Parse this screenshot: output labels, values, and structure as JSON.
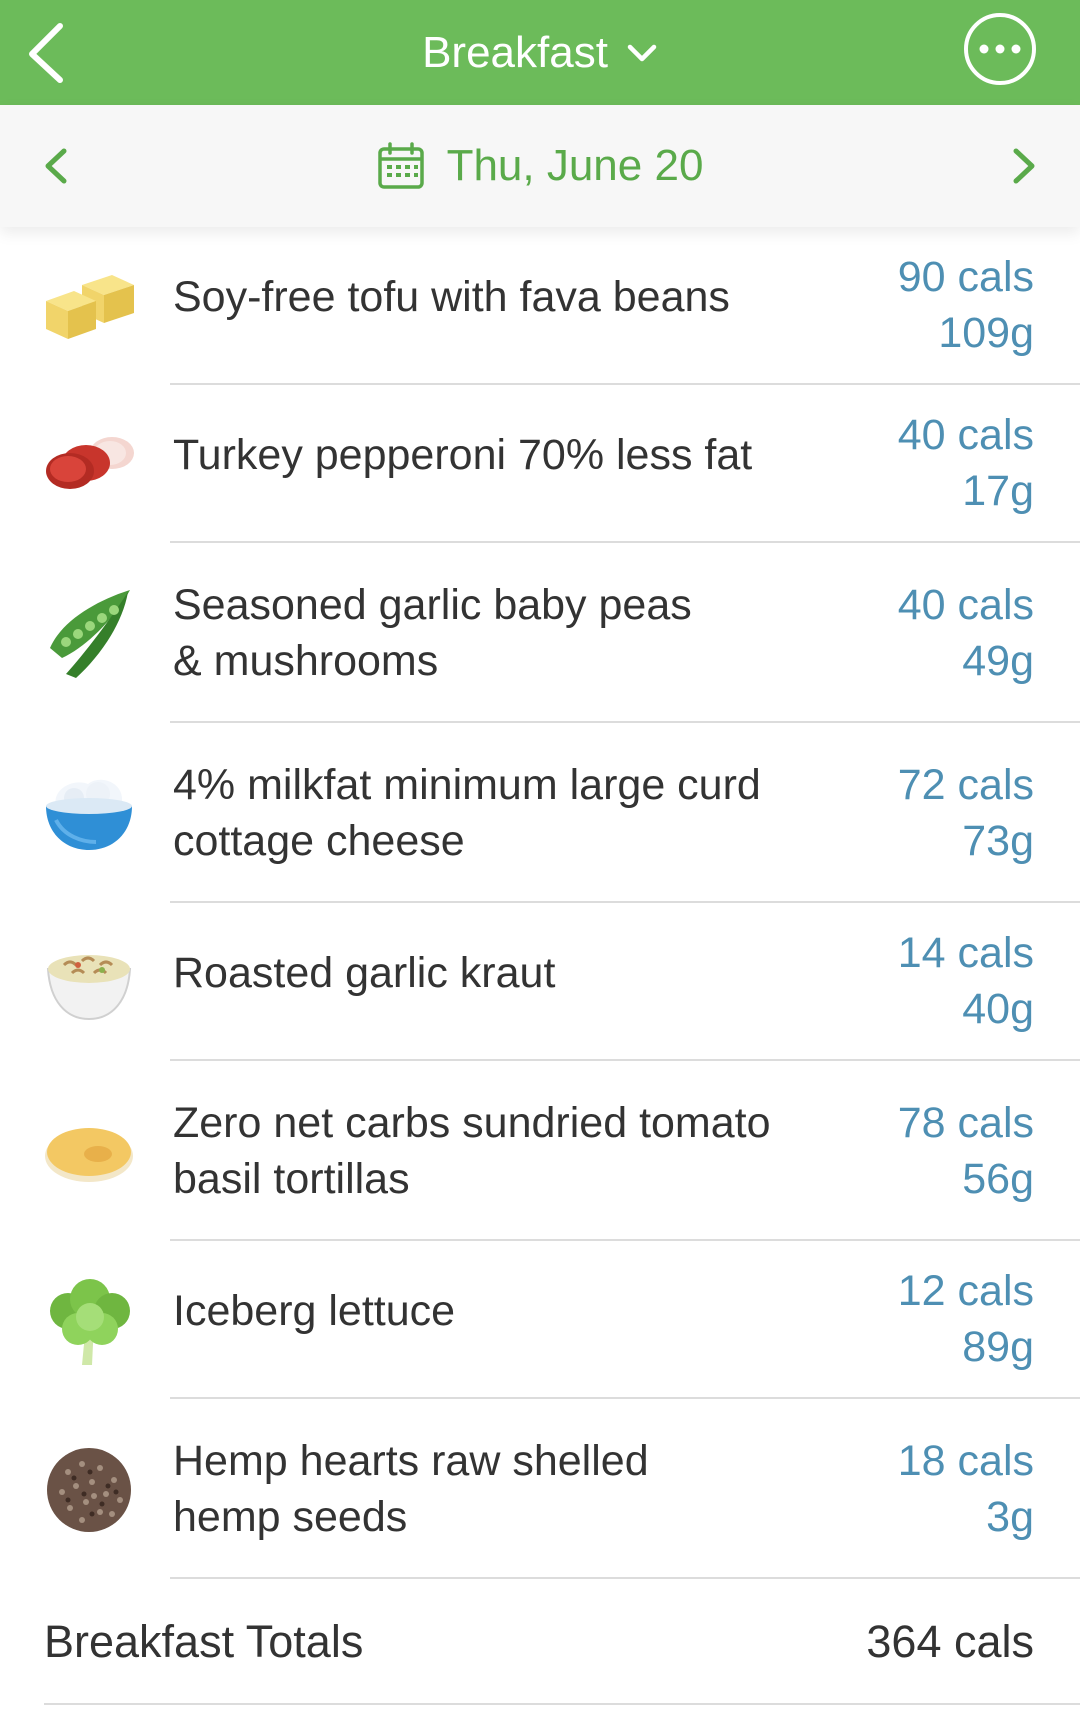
{
  "header": {
    "title": "Breakfast",
    "background_color": "#6cbb5a"
  },
  "date_nav": {
    "date": "Thu, June 20",
    "accent_color": "#5aaa4a"
  },
  "entries": [
    {
      "name": "Soy-free tofu with fava beans",
      "cals": "90 cals",
      "grams": "109g",
      "icon": "tofu-icon"
    },
    {
      "name": "Turkey pepperoni 70% less fat",
      "cals": "40 cals",
      "grams": "17g",
      "icon": "pepperoni-icon"
    },
    {
      "name": "Seasoned garlic baby peas\n& mushrooms",
      "cals": "40 cals",
      "grams": "49g",
      "icon": "peas-icon"
    },
    {
      "name": "4% milkfat minimum large curd\ncottage cheese",
      "cals": "72 cals",
      "grams": "73g",
      "icon": "cottage-cheese-icon"
    },
    {
      "name": "Roasted garlic kraut",
      "cals": "14 cals",
      "grams": "40g",
      "icon": "kraut-icon"
    },
    {
      "name": "Zero net carbs sundried tomato\nbasil tortillas",
      "cals": "78 cals",
      "grams": "56g",
      "icon": "tortilla-icon"
    },
    {
      "name": "Iceberg lettuce",
      "cals": "12 cals",
      "grams": "89g",
      "icon": "lettuce-icon"
    },
    {
      "name": "Hemp hearts raw shelled\nhemp seeds",
      "cals": "18 cals",
      "grams": "3g",
      "icon": "hemp-seeds-icon"
    }
  ],
  "totals": {
    "label": "Breakfast Totals",
    "value": "364 cals"
  },
  "colors": {
    "calorie_text": "#4e8fb3",
    "divider": "#dcdcdc"
  }
}
